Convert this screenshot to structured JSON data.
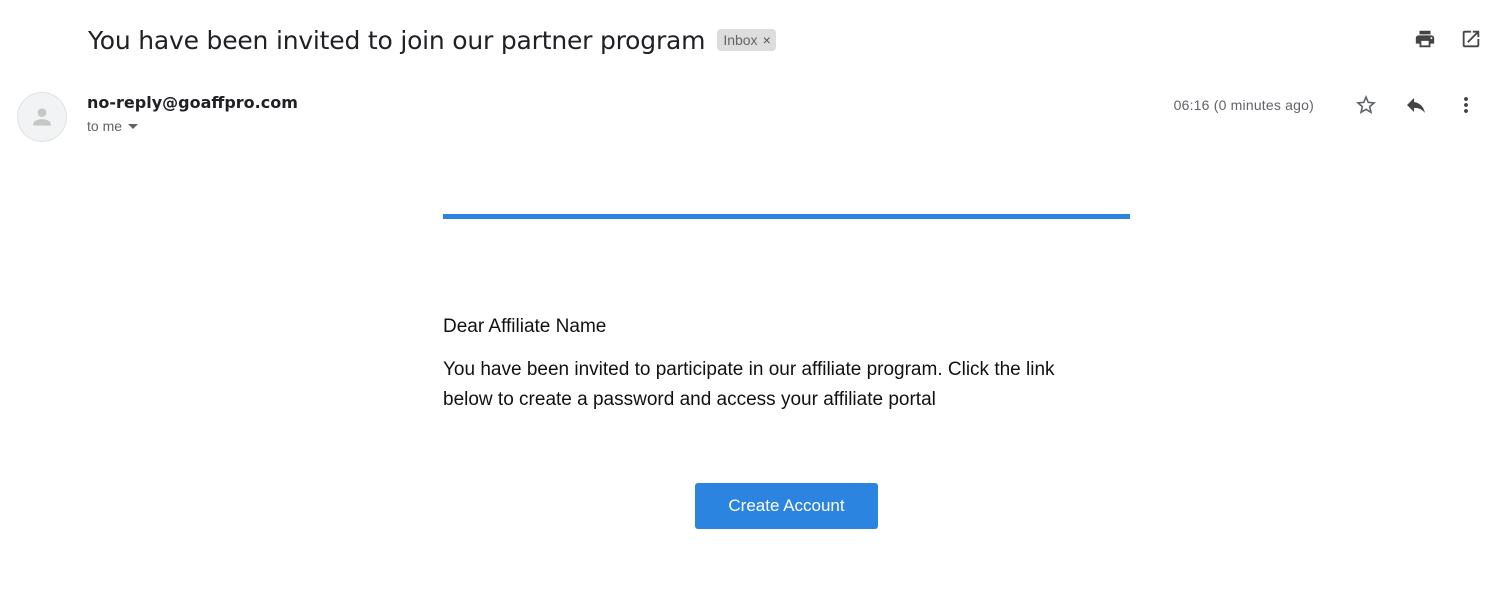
{
  "email": {
    "subject": "You have been invited to join our partner program",
    "label": "Inbox",
    "label_remove_glyph": "×",
    "sender": "no-reply@goaffpro.com",
    "recipient": "to me",
    "timestamp": "06:16 (0 minutes ago)"
  },
  "toolbar": {
    "icons": [
      "print-icon",
      "open-in-new-window-icon",
      "star-icon",
      "reply-icon",
      "more-vert-icon"
    ]
  },
  "body": {
    "greeting": "Dear Affiliate Name",
    "message": "You have been invited to participate in our affiliate program. Click the link below to create a password and access your affiliate portal",
    "cta_label": "Create Account"
  },
  "colors": {
    "accent": "#2a84e0",
    "chip_bg": "#dddddd",
    "icon": "#5f6368"
  }
}
